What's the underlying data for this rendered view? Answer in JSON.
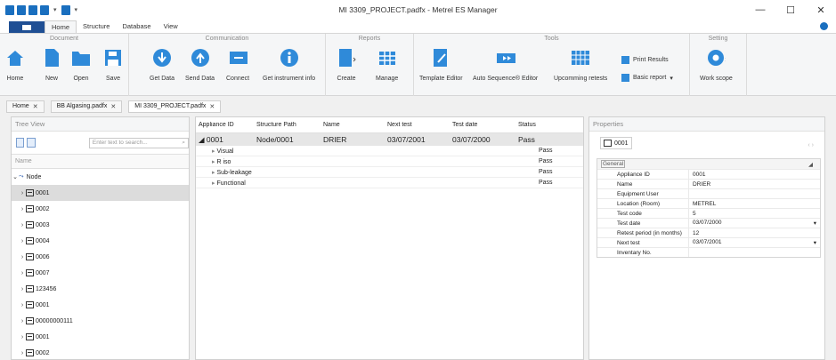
{
  "window": {
    "title": "MI 3309_PROJECT.padfx - Metrel ES Manager",
    "controls": [
      "—",
      "☐",
      "✕"
    ]
  },
  "menu": {
    "tabs": [
      "Home",
      "Structure",
      "Database",
      "View"
    ]
  },
  "ribbon": {
    "groups": {
      "document": "Document",
      "communication": "Communication",
      "reports": "Reports",
      "tools": "Tools",
      "setting": "Setting"
    },
    "buttons": {
      "home": "Home",
      "new": "New",
      "open": "Open",
      "save": "Save",
      "get_data": "Get Data",
      "send_data": "Send Data",
      "connect": "Connect",
      "get_instrument_info": "Get instrument info",
      "create": "Create",
      "manage": "Manage",
      "template_editor": "Template Editor",
      "auto_sequence_editor": "Auto Sequence® Editor",
      "upcoming_retests": "Upcomming retests",
      "print_results": "Print Results",
      "basic_report": "Basic report",
      "work_scope": "Work scope"
    }
  },
  "doc_tabs": [
    {
      "label": "Home"
    },
    {
      "label": "BB Algasing.padfx"
    },
    {
      "label": "MI 3309_PROJECT.padfx"
    }
  ],
  "tree": {
    "title": "Tree View",
    "search_placeholder": "Enter text to search...",
    "column": "Name",
    "root": "Node",
    "items": [
      "0001",
      "0002",
      "0003",
      "0004",
      "0006",
      "0007",
      "123456",
      "0001",
      "00000000111",
      "0001",
      "0002"
    ]
  },
  "grid": {
    "headers": [
      "Appliance ID",
      "Structure Path",
      "Name",
      "Next test",
      "Test date",
      "Status"
    ],
    "row": [
      "0001",
      "Node/0001",
      "DRIER",
      "03/07/2001",
      "03/07/2000",
      "Pass"
    ],
    "subrows": [
      {
        "name": "Visual",
        "status": "Pass"
      },
      {
        "name": "R iso",
        "status": "Pass"
      },
      {
        "name": "Sub-leakage",
        "status": "Pass"
      },
      {
        "name": "Functional",
        "status": "Pass"
      }
    ]
  },
  "properties": {
    "title": "Properties",
    "tab": "0001",
    "section": "General",
    "rows": [
      {
        "k": "Appliance ID",
        "v": "0001"
      },
      {
        "k": "Name",
        "v": "DRIER"
      },
      {
        "k": "Equipment User",
        "v": ""
      },
      {
        "k": "Location (Room)",
        "v": "METREL"
      },
      {
        "k": "Test code",
        "v": "5"
      },
      {
        "k": "Test date",
        "v": "03/07/2000"
      },
      {
        "k": "Retest period (in months)",
        "v": "12"
      },
      {
        "k": "Next test",
        "v": "03/07/2001"
      },
      {
        "k": "Inventary No.",
        "v": ""
      }
    ]
  }
}
